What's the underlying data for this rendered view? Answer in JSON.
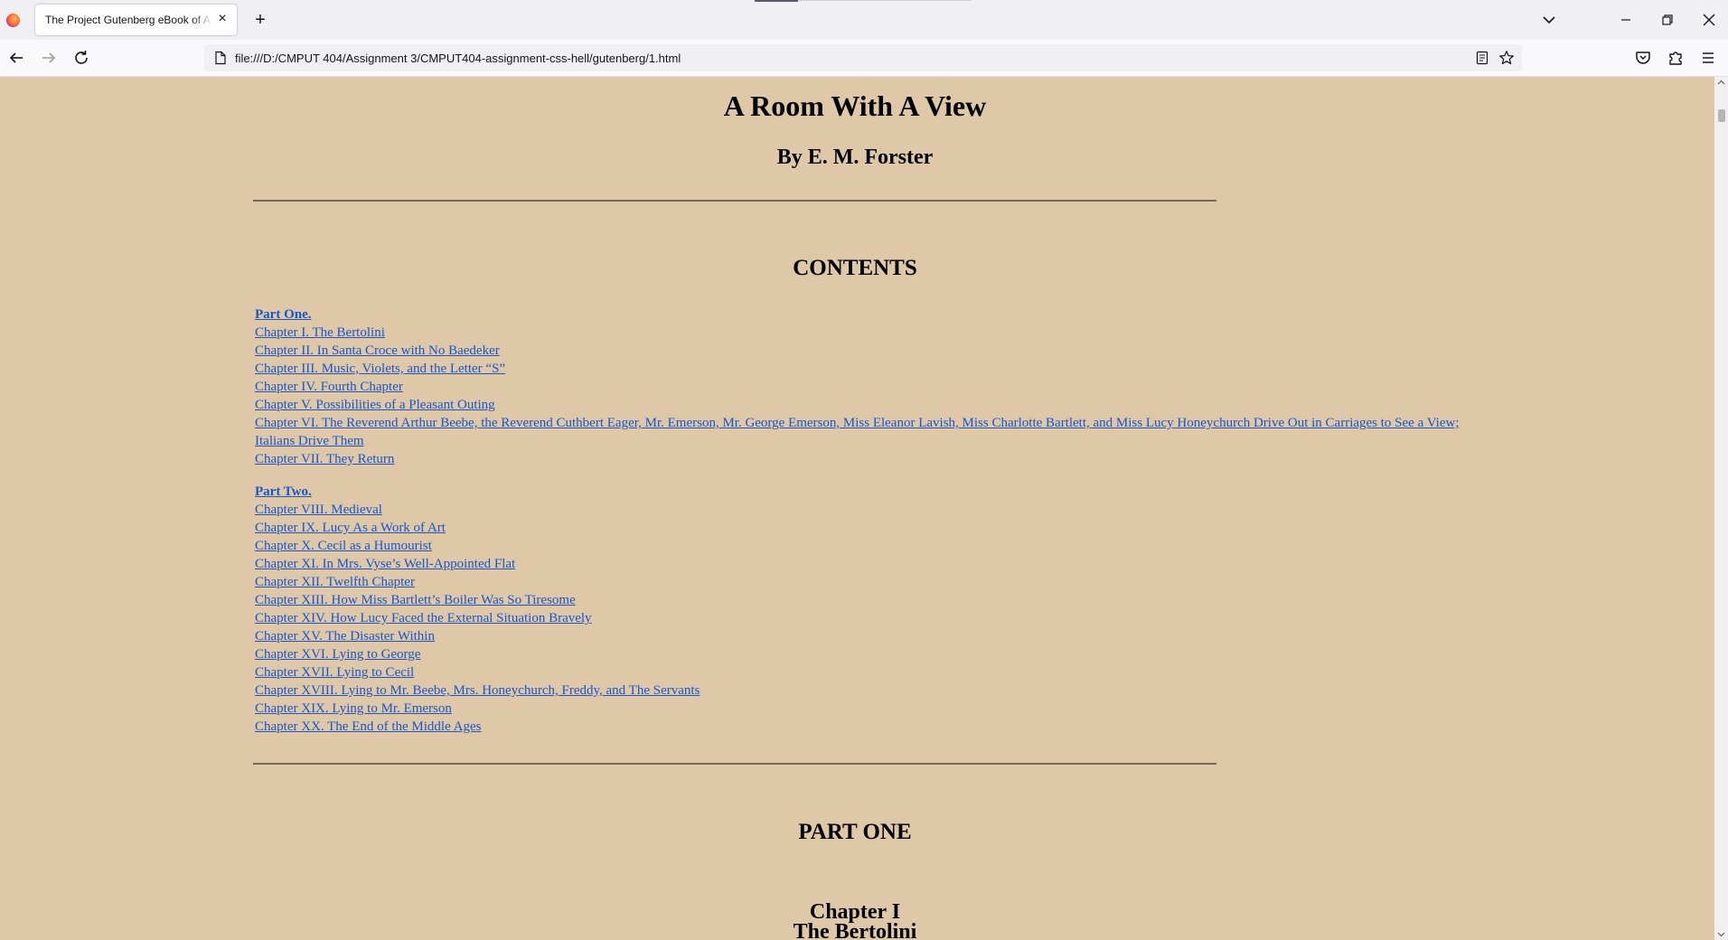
{
  "browser": {
    "tab_title": "The Project Gutenberg eBook of A Room With A View",
    "url": "file:///D:/CMPUT 404/Assignment 3/CMPUT404-assignment-css-hell/gutenberg/1.html"
  },
  "book": {
    "title": "A Room With A View",
    "author": "By E. M. Forster",
    "contents_heading": "CONTENTS",
    "part_one_link": "Part One.",
    "part_one_chapters": [
      "Chapter I. The Bertolini",
      "Chapter II. In Santa Croce with No Baedeker",
      "Chapter III. Music, Violets, and the Letter “S”",
      "Chapter IV. Fourth Chapter",
      "Chapter V. Possibilities of a Pleasant Outing",
      "Chapter VI. The Reverend Arthur Beebe, the Reverend Cuthbert Eager, Mr. Emerson, Mr. George Emerson, Miss Eleanor Lavish, Miss Charlotte Bartlett, and Miss Lucy Honeychurch Drive Out in Carriages to See a View; Italians Drive Them",
      "Chapter VII. They Return"
    ],
    "part_two_link": "Part Two.",
    "part_two_chapters": [
      "Chapter VIII. Medieval",
      "Chapter IX. Lucy As a Work of Art",
      "Chapter X. Cecil as a Humourist",
      "Chapter XI. In Mrs. Vyse’s Well-Appointed Flat",
      "Chapter XII. Twelfth Chapter",
      "Chapter XIII. How Miss Bartlett’s Boiler Was So Tiresome",
      "Chapter XIV. How Lucy Faced the External Situation Bravely",
      "Chapter XV. The Disaster Within",
      "Chapter XVI. Lying to George",
      "Chapter XVII. Lying to Cecil",
      "Chapter XVIII. Lying to Mr. Beebe, Mrs. Honeychurch, Freddy, and The Servants",
      "Chapter XIX. Lying to Mr. Emerson",
      "Chapter XX. The End of the Middle Ages"
    ],
    "part_one_heading": "PART ONE",
    "chapter_one_heading": "Chapter I",
    "chapter_one_title": "The Bertolini"
  },
  "colors": {
    "page_background": "#dec8a8",
    "link": "#1a56c7"
  },
  "icons": {
    "browser_logo": "firefox-logo-icon",
    "tab_close": "close-icon",
    "new_tab": "plus-icon",
    "tab_list": "chevron-down-icon",
    "back": "arrow-left-icon",
    "forward": "arrow-right-icon",
    "reload": "reload-icon",
    "page": "page-icon",
    "reader": "reader-view-icon",
    "bookmark": "star-icon",
    "pocket": "pocket-icon",
    "extensions": "puzzle-icon",
    "menu": "hamburger-menu-icon"
  }
}
